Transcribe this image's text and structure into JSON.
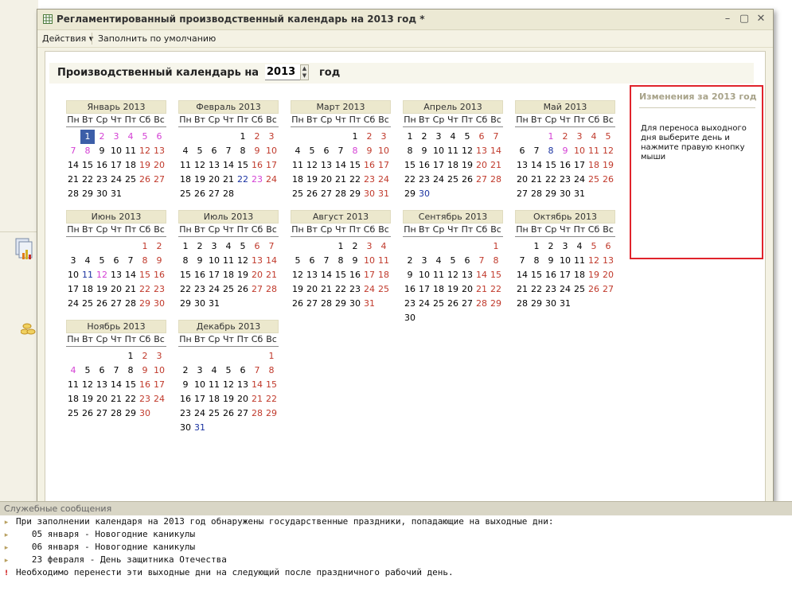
{
  "window": {
    "title": "Регламентированный производственный календарь на 2013 год *",
    "toolbar": {
      "actions_label": "Действия ▾",
      "fill_default_label": "Заполнить по умолчанию"
    }
  },
  "header": {
    "label": "Производственный календарь на",
    "year_value": "2013",
    "year_suffix": "год"
  },
  "weekdays": [
    "Пн",
    "Вт",
    "Ср",
    "Чт",
    "Пт",
    "Сб",
    "Вс"
  ],
  "colors": {
    "weekend": "#c0392b",
    "preholiday": "#d43fd4",
    "moved_day": "#1a32a0",
    "selected": "#3c5ea8",
    "panel_border": "#e0232b"
  },
  "months": [
    {
      "title": "Январь 2013",
      "start": 1,
      "len": 31,
      "weekends": [
        1,
        2,
        3,
        4,
        5,
        6,
        7,
        8,
        12,
        13,
        19,
        20,
        26,
        27
      ],
      "special": {
        "1": "sel",
        "2": "mag",
        "3": "mag",
        "4": "mag",
        "5": "mag",
        "6": "mag",
        "7": "mag",
        "8": "mag"
      }
    },
    {
      "title": "Февраль 2013",
      "start": 4,
      "len": 28,
      "weekends": [
        2,
        3,
        9,
        10,
        16,
        17,
        23,
        24
      ],
      "special": {
        "22": "blue",
        "23": "mag"
      }
    },
    {
      "title": "Март 2013",
      "start": 4,
      "len": 31,
      "weekends": [
        2,
        3,
        8,
        9,
        10,
        16,
        17,
        23,
        24,
        30,
        31
      ],
      "special": {
        "8": "mag"
      }
    },
    {
      "title": "Апрель 2013",
      "start": 0,
      "len": 30,
      "weekends": [
        6,
        7,
        13,
        14,
        20,
        21,
        27,
        28
      ],
      "special": {
        "30": "blue"
      }
    },
    {
      "title": "Май 2013",
      "start": 2,
      "len": 31,
      "weekends": [
        1,
        2,
        3,
        4,
        5,
        9,
        10,
        11,
        12,
        18,
        19,
        25,
        26
      ],
      "special": {
        "1": "mag",
        "8": "blue",
        "9": "mag"
      }
    },
    {
      "title": "Июнь 2013",
      "start": 5,
      "len": 30,
      "weekends": [
        1,
        2,
        8,
        9,
        12,
        15,
        16,
        22,
        23,
        29,
        30
      ],
      "special": {
        "11": "blue",
        "12": "mag"
      }
    },
    {
      "title": "Июль 2013",
      "start": 0,
      "len": 31,
      "weekends": [
        6,
        7,
        13,
        14,
        20,
        21,
        27,
        28
      ],
      "special": {}
    },
    {
      "title": "Август 2013",
      "start": 3,
      "len": 31,
      "weekends": [
        3,
        4,
        10,
        11,
        17,
        18,
        24,
        25,
        31
      ],
      "special": {}
    },
    {
      "title": "Сентябрь 2013",
      "start": 6,
      "len": 30,
      "weekends": [
        1,
        7,
        8,
        14,
        15,
        21,
        22,
        28,
        29
      ],
      "special": {}
    },
    {
      "title": "Октябрь 2013",
      "start": 1,
      "len": 31,
      "weekends": [
        5,
        6,
        12,
        13,
        19,
        20,
        26,
        27
      ],
      "special": {}
    },
    {
      "title": "Ноябрь 2013",
      "start": 4,
      "len": 30,
      "weekends": [
        2,
        3,
        4,
        9,
        10,
        16,
        17,
        23,
        24,
        30
      ],
      "special": {
        "4": "mag"
      }
    },
    {
      "title": "Декабрь 2013",
      "start": 6,
      "len": 31,
      "weekends": [
        1,
        7,
        8,
        14,
        15,
        21,
        22,
        28,
        29
      ],
      "special": {
        "31": "blue"
      }
    }
  ],
  "side_panel": {
    "title": "Изменения за 2013 год",
    "text": "Для переноса выходного дня выберите день и нажмите правую кнопку мыши"
  },
  "messages": {
    "title": "Служебные сообщения",
    "lines": [
      "При заполнении календаря на 2013 год обнаружены государственные праздники, попадающие на выходные дни:",
      "   05 января - Новогодние каникулы",
      "   06 января - Новогодние каникулы",
      "   23 февраля - День защитника Отечества",
      "Необходимо перенести эти выходные дни на следующий после праздничного рабочий день."
    ]
  }
}
